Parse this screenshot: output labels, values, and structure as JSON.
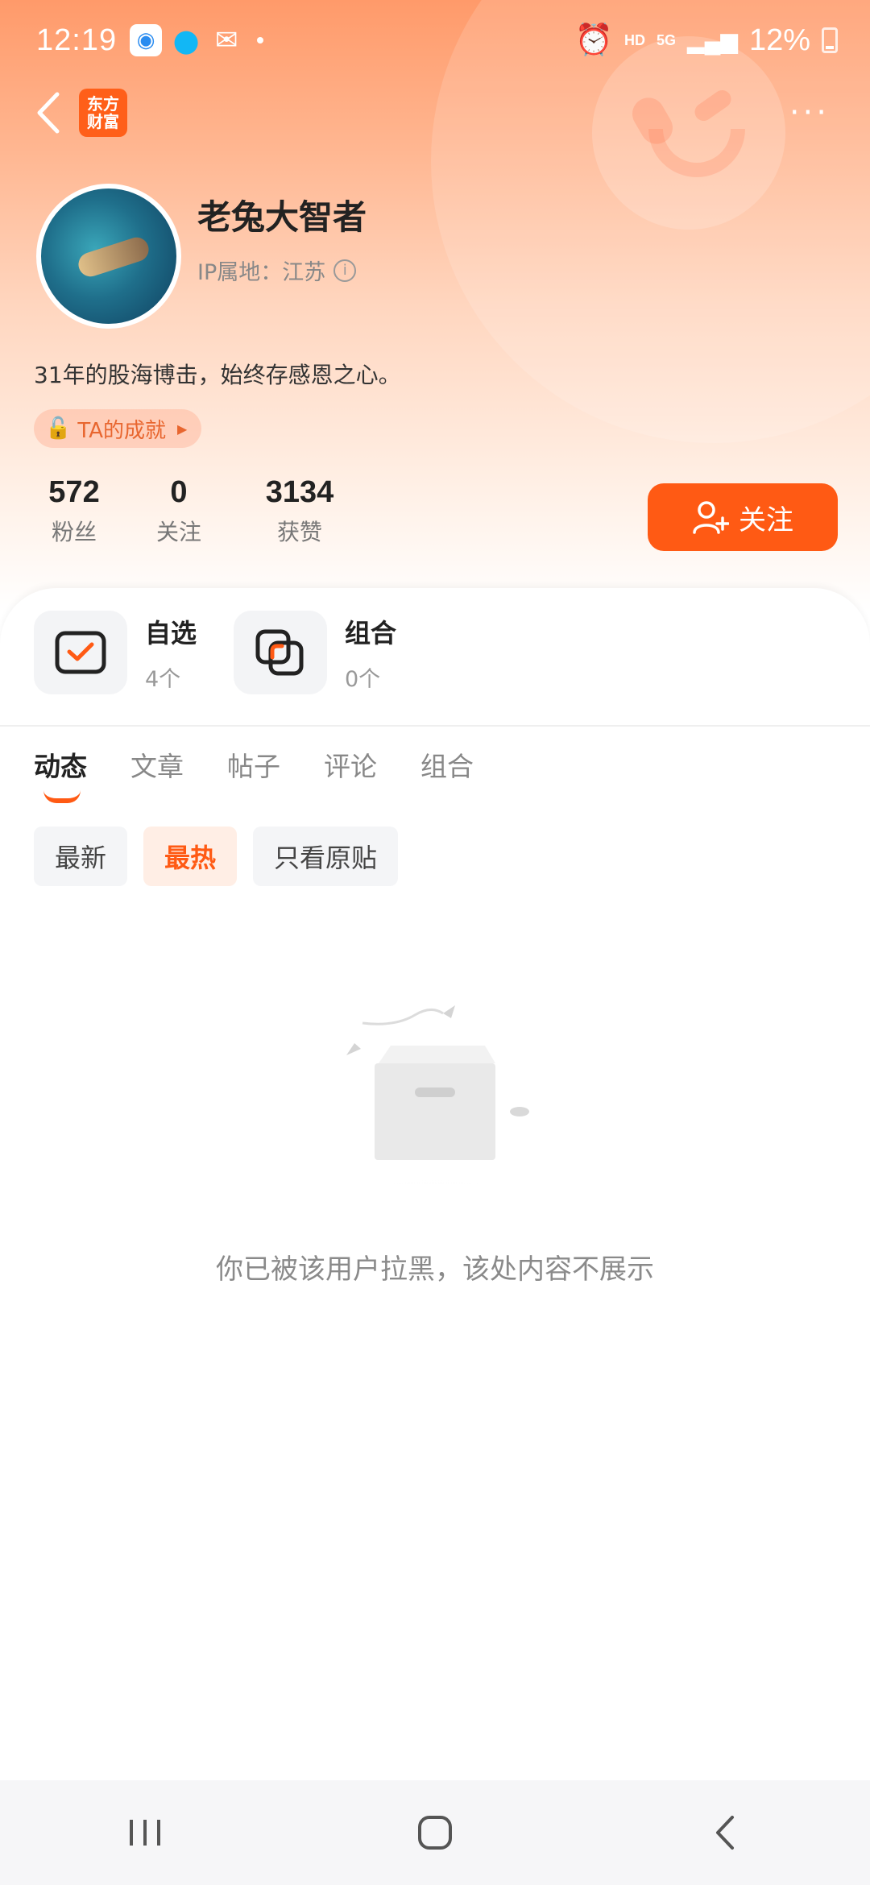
{
  "status_bar": {
    "time": "12:19",
    "hd": "HD",
    "net": "5G",
    "battery": "12%"
  },
  "header": {
    "logo_line1": "东方",
    "logo_line2": "财富",
    "more": "···"
  },
  "profile": {
    "name": "老兔大智者",
    "ip": "IP属地：江苏",
    "bio": "31年的股海博击，始终存感恩之心。",
    "achievement": "TA的成就",
    "stats": [
      {
        "value": "572",
        "label": "粉丝"
      },
      {
        "value": "0",
        "label": "关注"
      },
      {
        "value": "3134",
        "label": "获赞"
      }
    ],
    "follow_label": "关注"
  },
  "quick": [
    {
      "title": "自选",
      "count": "4个"
    },
    {
      "title": "组合",
      "count": "0个"
    }
  ],
  "tabs": [
    "动态",
    "文章",
    "帖子",
    "评论",
    "组合"
  ],
  "filters": [
    "最新",
    "最热",
    "只看原贴"
  ],
  "empty_message": "你已被该用户拉黑，该处内容不展示",
  "colors": {
    "accent": "#ff5a14",
    "header_gradient_top": "#ff9a6a"
  }
}
